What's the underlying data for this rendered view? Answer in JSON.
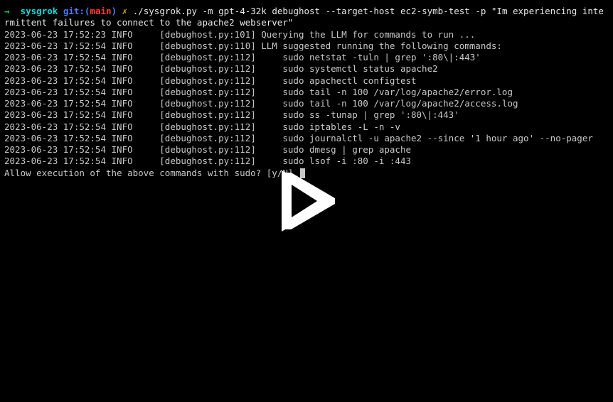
{
  "prompt": {
    "arrow": "→",
    "cwd": "sysgrok",
    "git_label": "git:",
    "paren_open": "(",
    "branch": "main",
    "paren_close": ")",
    "symbol": "✗",
    "command": "./sysgrok.py -m gpt-4-32k debughost --target-host ec2-symb-test -p \"Im experiencing intermittent failures to connect to the apache2 webserver\""
  },
  "log_lines": [
    {
      "ts": "2023-06-23 17:52:23",
      "level": "INFO",
      "src": "[debughost.py:101]",
      "msg": "Querying the LLM for commands to run ..."
    },
    {
      "ts": "2023-06-23 17:52:54",
      "level": "INFO",
      "src": "[debughost.py:110]",
      "msg": "LLM suggested running the following commands:"
    },
    {
      "ts": "2023-06-23 17:52:54",
      "level": "INFO",
      "src": "[debughost.py:112]",
      "msg": "    sudo netstat -tuln | grep ':80\\|:443'"
    },
    {
      "ts": "2023-06-23 17:52:54",
      "level": "INFO",
      "src": "[debughost.py:112]",
      "msg": "    sudo systemctl status apache2"
    },
    {
      "ts": "2023-06-23 17:52:54",
      "level": "INFO",
      "src": "[debughost.py:112]",
      "msg": "    sudo apachectl configtest"
    },
    {
      "ts": "2023-06-23 17:52:54",
      "level": "INFO",
      "src": "[debughost.py:112]",
      "msg": "    sudo tail -n 100 /var/log/apache2/error.log"
    },
    {
      "ts": "2023-06-23 17:52:54",
      "level": "INFO",
      "src": "[debughost.py:112]",
      "msg": "    sudo tail -n 100 /var/log/apache2/access.log"
    },
    {
      "ts": "2023-06-23 17:52:54",
      "level": "INFO",
      "src": "[debughost.py:112]",
      "msg": "    sudo ss -tunap | grep ':80\\|:443'"
    },
    {
      "ts": "2023-06-23 17:52:54",
      "level": "INFO",
      "src": "[debughost.py:112]",
      "msg": "    sudo iptables -L -n -v"
    },
    {
      "ts": "2023-06-23 17:52:54",
      "level": "INFO",
      "src": "[debughost.py:112]",
      "msg": "    sudo journalctl -u apache2 --since '1 hour ago' --no-pager"
    },
    {
      "ts": "2023-06-23 17:52:54",
      "level": "INFO",
      "src": "[debughost.py:112]",
      "msg": "    sudo dmesg | grep apache"
    },
    {
      "ts": "2023-06-23 17:52:54",
      "level": "INFO",
      "src": "[debughost.py:112]",
      "msg": "    sudo lsof -i :80 -i :443"
    }
  ],
  "confirm_prompt": "Allow execution of the above commands with sudo? [y/N] ",
  "play_icon_name": "play-icon",
  "colors": {
    "bg": "#000000",
    "fg": "#c8c8c8",
    "arrow": "#00d060",
    "cwd": "#00e0e0",
    "git": "#4a7cff",
    "branch": "#ff3b30",
    "symbol": "#c8a000",
    "play": "#ffffff"
  }
}
